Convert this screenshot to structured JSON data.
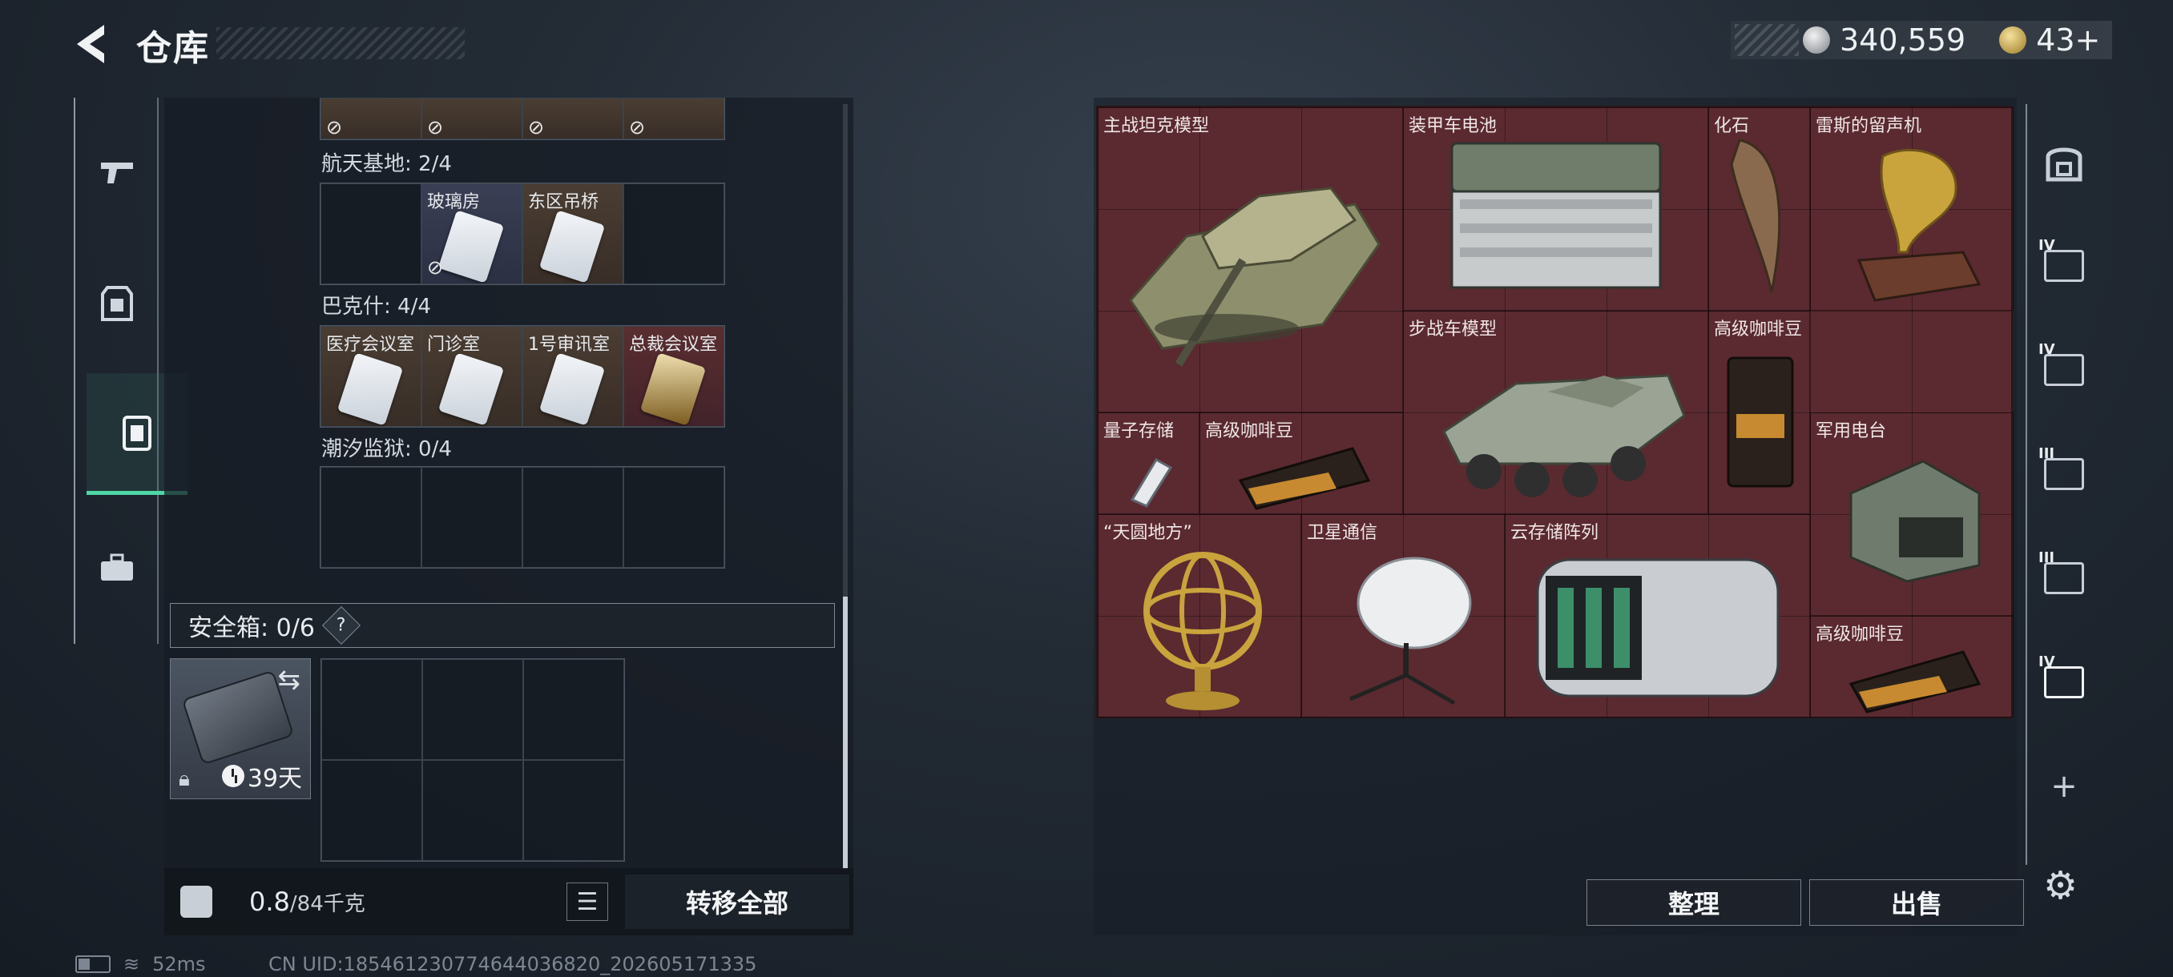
{
  "header": {
    "title": "仓库"
  },
  "currency": {
    "silver": "340,559",
    "gold": "43+"
  },
  "left_nav": {
    "items": [
      {
        "name": "weapons",
        "icon": "gun-icon"
      },
      {
        "name": "gear",
        "icon": "armor-icon"
      },
      {
        "name": "keys",
        "icon": "keycard-icon"
      },
      {
        "name": "items",
        "icon": "toolbox-icon"
      }
    ]
  },
  "keycards": {
    "groups": [
      {
        "label": "航天基地: 2/4",
        "cells": [
          {
            "label": "",
            "owned": false
          },
          {
            "label": "玻璃房",
            "owned": false,
            "color": "blue"
          },
          {
            "label": "东区吊桥",
            "owned": true,
            "color": "orange"
          },
          {
            "label": "",
            "owned": false
          }
        ]
      },
      {
        "label": "巴克什: 4/4",
        "cells": [
          {
            "label": "医疗会议室",
            "owned": true,
            "color": "orange"
          },
          {
            "label": "门诊室",
            "owned": true,
            "color": "orange"
          },
          {
            "label": "1号审讯室",
            "owned": true,
            "color": "orange"
          },
          {
            "label": "总裁会议室",
            "owned": true,
            "color": "red"
          }
        ]
      },
      {
        "label": "潮汐监狱: 0/4",
        "cells": [
          {
            "label": "",
            "owned": false
          },
          {
            "label": "",
            "owned": false
          },
          {
            "label": "",
            "owned": false
          },
          {
            "label": "",
            "owned": false
          }
        ]
      }
    ]
  },
  "safebox": {
    "label": "安全箱: 0/6",
    "help": "?",
    "days": "39天"
  },
  "bottom": {
    "weight_current": "0.8",
    "weight_max": "/84千克",
    "transfer": "转移全部"
  },
  "status": {
    "ping": "52ms",
    "uid": "CN UID:185461230774644036820_202605171335"
  },
  "container": {
    "items": [
      {
        "name": "主战坦克模型",
        "icon": "tank-model-icon"
      },
      {
        "name": "装甲车电池",
        "icon": "battery-icon"
      },
      {
        "name": "化石",
        "icon": "fossil-icon"
      },
      {
        "name": "雷斯的留声机",
        "icon": "gramophone-icon"
      },
      {
        "name": "步战车模型",
        "icon": "ifv-model-icon"
      },
      {
        "name": "高级咖啡豆",
        "icon": "coffee-bag-icon"
      },
      {
        "name": "量子存储",
        "icon": "usb-drive-icon"
      },
      {
        "name": "高级咖啡豆",
        "icon": "coffee-bag-icon"
      },
      {
        "name": "军用电台",
        "icon": "radio-icon"
      },
      {
        "name": "“天圆地方”",
        "icon": "armillary-icon"
      },
      {
        "name": "卫星通信",
        "icon": "satellite-dish-icon"
      },
      {
        "name": "云存储阵列",
        "icon": "server-array-icon"
      },
      {
        "name": "高级咖啡豆",
        "icon": "coffee-bag-icon"
      }
    ]
  },
  "actions": {
    "arrange": "整理",
    "sell": "出售"
  },
  "right_nav": {
    "tabs": [
      {
        "icon": "backpack-icon",
        "tier": ""
      },
      {
        "icon": "folder-icon",
        "tier": "IV"
      },
      {
        "icon": "case-icon",
        "tier": "IV"
      },
      {
        "icon": "warning-box-icon",
        "tier": "III"
      },
      {
        "icon": "gun-case-icon",
        "tier": "III"
      },
      {
        "icon": "case-icon",
        "tier": "IV"
      }
    ],
    "add": "+"
  },
  "colors": {
    "accent": "#4fd6a6",
    "container_bg": "#5a2a30"
  }
}
